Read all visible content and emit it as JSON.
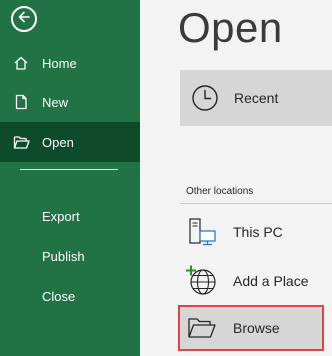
{
  "sidebar": {
    "back_icon": "arrow-left-circle-icon",
    "items": [
      {
        "label": "Home",
        "icon": "home-icon"
      },
      {
        "label": "New",
        "icon": "new-document-icon"
      },
      {
        "label": "Open",
        "icon": "folder-open-icon",
        "selected": true
      },
      {
        "label": "Export"
      },
      {
        "label": "Publish"
      },
      {
        "label": "Close"
      }
    ],
    "background_color": "#217346",
    "selected_color": "#0e4b2b"
  },
  "main": {
    "title": "Open",
    "recent": {
      "label": "Recent",
      "icon": "clock-icon"
    },
    "section_header": "Other locations",
    "locations": [
      {
        "label": "This PC",
        "icon": "this-pc-icon"
      },
      {
        "label": "Add a Place",
        "icon": "add-place-globe-icon"
      },
      {
        "label": "Browse",
        "icon": "folder-browse-icon",
        "highlighted": true
      }
    ],
    "highlight_color": "#e04545"
  }
}
